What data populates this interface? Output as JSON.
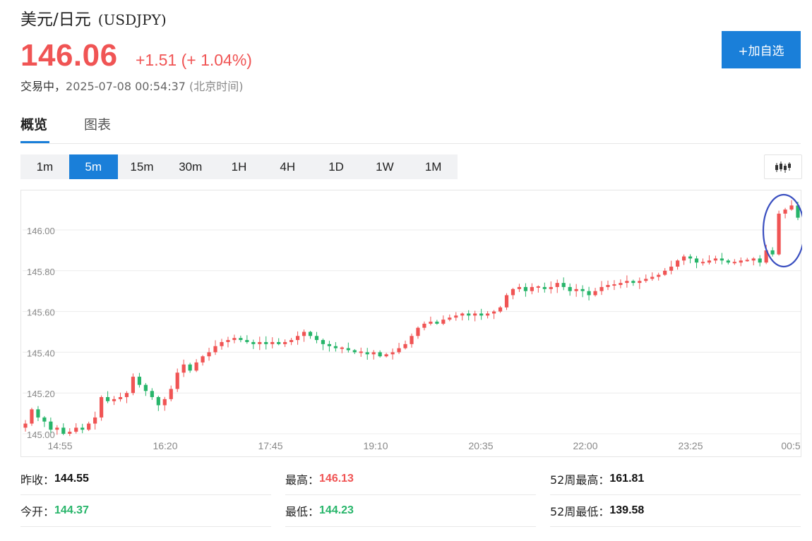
{
  "header": {
    "name": "美元/日元",
    "code": "(USDJPY)",
    "price": "146.06",
    "change": "+1.51 (+ 1.04%)",
    "status": "交易中，",
    "time": "2025-07-08 00:54:37",
    "timezone": "(北京时间)",
    "add_label": "+加自选"
  },
  "tabs": [
    {
      "label": "概览",
      "active": true
    },
    {
      "label": "图表",
      "active": false
    }
  ],
  "periods": [
    "1m",
    "5m",
    "15m",
    "30m",
    "1H",
    "4H",
    "1D",
    "1W",
    "1M"
  ],
  "active_period": "5m",
  "chart_type_icon": "candlestick-icon",
  "colors": {
    "up": "#f05454",
    "down": "#27b56a",
    "accent": "#1a7fd9",
    "annotation": "#3a4fc0"
  },
  "chart_data": {
    "type": "candlestick",
    "y_ticks": [
      "146.00",
      "145.80",
      "145.60",
      "145.40",
      "145.20",
      "145.00"
    ],
    "x_ticks": [
      "14:55",
      "16:20",
      "17:45",
      "19:10",
      "20:35",
      "22:00",
      "23:25",
      "00:5"
    ],
    "ylim": [
      144.97,
      146.3
    ],
    "grid": true,
    "annotation": "circle around latest candles",
    "candles_close": [
      145.05,
      145.12,
      145.08,
      145.06,
      145.02,
      145.03,
      145.0,
      145.01,
      145.03,
      145.02,
      145.05,
      145.08,
      145.18,
      145.16,
      145.17,
      145.18,
      145.2,
      145.28,
      145.24,
      145.21,
      145.18,
      145.14,
      145.17,
      145.22,
      145.3,
      145.34,
      145.31,
      145.35,
      145.38,
      145.4,
      145.43,
      145.45,
      145.46,
      145.47,
      145.46,
      145.45,
      145.44,
      145.45,
      145.44,
      145.45,
      145.44,
      145.45,
      145.46,
      145.48,
      145.5,
      145.48,
      145.46,
      145.44,
      145.43,
      145.42,
      145.42,
      145.41,
      145.4,
      145.4,
      145.39,
      145.4,
      145.38,
      145.39,
      145.4,
      145.42,
      145.44,
      145.48,
      145.52,
      145.54,
      145.55,
      145.54,
      145.56,
      145.57,
      145.58,
      145.59,
      145.58,
      145.59,
      145.58,
      145.59,
      145.6,
      145.62,
      145.68,
      145.71,
      145.72,
      145.7,
      145.72,
      145.72,
      145.71,
      145.72,
      145.74,
      145.72,
      145.7,
      145.71,
      145.7,
      145.68,
      145.7,
      145.72,
      145.73,
      145.73,
      145.74,
      145.75,
      145.74,
      145.75,
      145.76,
      145.77,
      145.78,
      145.8,
      145.82,
      145.85,
      145.87,
      145.86,
      145.84,
      145.84,
      145.85,
      145.86,
      145.85,
      145.84,
      145.84,
      145.85,
      145.85,
      145.86,
      145.84,
      145.9,
      145.88,
      146.08,
      146.1,
      146.12,
      146.06
    ]
  },
  "stats": [
    {
      "label": "昨收：",
      "value": "144.55",
      "tone": "dark"
    },
    {
      "label": "最高：",
      "value": "146.13",
      "tone": "up"
    },
    {
      "label": "52周最高：",
      "value": "161.81",
      "tone": "dark"
    },
    {
      "label": "今开：",
      "value": "144.37",
      "tone": "down"
    },
    {
      "label": "最低：",
      "value": "144.23",
      "tone": "down"
    },
    {
      "label": "52周最低：",
      "value": "139.58",
      "tone": "dark"
    }
  ]
}
